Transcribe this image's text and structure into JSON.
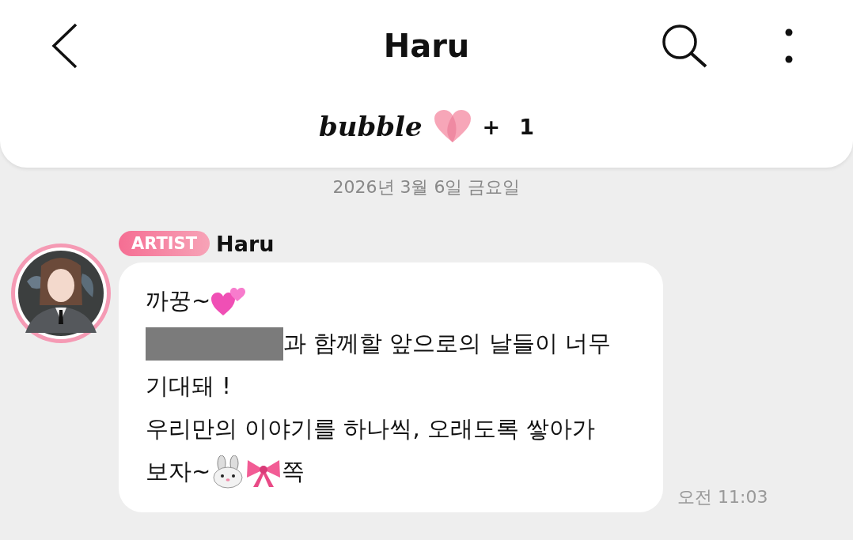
{
  "header": {
    "title": "Haru",
    "subscription": {
      "brand": "bubble",
      "plus": "+",
      "count": "1"
    }
  },
  "date_divider": "2026년 3월 6일 금요일",
  "messages": [
    {
      "badge": "ARTIST",
      "sender": "Haru",
      "time": "오전 11:03",
      "lines": [
        {
          "segments": [
            {
              "kind": "text",
              "text": "까꿍~"
            },
            {
              "kind": "hearts"
            }
          ]
        },
        {
          "segments": [
            {
              "kind": "redacted"
            },
            {
              "kind": "text",
              "text": "과 함께할 앞으로의 날들이 너무"
            }
          ]
        },
        {
          "segments": [
            {
              "kind": "text",
              "text": "기대돼 !"
            }
          ]
        },
        {
          "segments": [
            {
              "kind": "text",
              "text": "우리만의 이야기를 하나씩, 오래도록 쌓아가"
            }
          ]
        },
        {
          "segments": [
            {
              "kind": "text",
              "text": "보자~"
            },
            {
              "kind": "rabbit"
            },
            {
              "kind": "bow"
            },
            {
              "kind": "text",
              "text": "쪽"
            }
          ]
        }
      ]
    }
  ]
}
